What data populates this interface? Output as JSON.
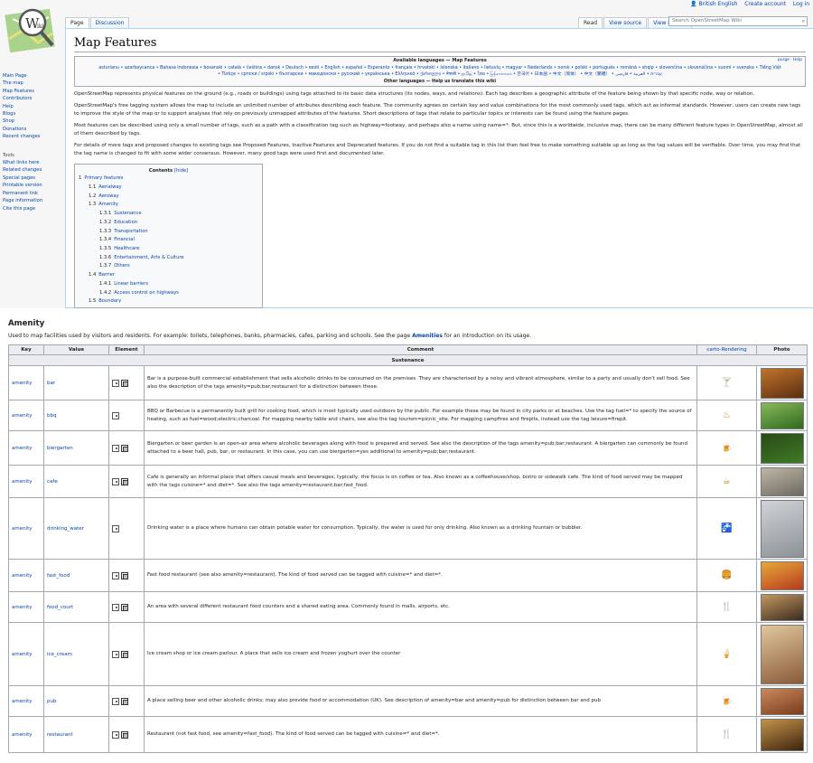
{
  "personal": {
    "lang": "British English",
    "create": "Create account",
    "login": "Log in"
  },
  "tabs": {
    "page": "Page",
    "discussion": "Discussion",
    "read": "Read",
    "view_source": "View source",
    "view_history": "View history"
  },
  "search": {
    "placeholder": "Search OpenStreetMap Wiki"
  },
  "sidebar": {
    "nav": [
      "Main Page",
      "The map",
      "Map Features",
      "Contributors",
      "Help",
      "Blogs",
      "Shop",
      "Donations",
      "Recent changes"
    ],
    "tools_heading": "Tools",
    "tools": [
      "What links here",
      "Related changes",
      "Special pages",
      "Printable version",
      "Permanent link",
      "Page information",
      "Cite this page"
    ]
  },
  "page": {
    "title": "Map Features"
  },
  "langbox": {
    "heading": "Available languages — Map Features",
    "tools": "purge · Help",
    "line1": "asturianu • azərbaycanca • Bahasa Indonesia • bosanski • català • čeština • dansk • Deutsch • eesti • English • español • Esperanto • français • hrvatski • íslenska • italiano • lietuvių • magyar • Nederlands • norsk • polski • português • română • shqip • slovenčina • slovenščina • suomi • svenska • Tiếng Việt",
    "line2": "• Türkçe • српски / srpski • български • македонски • русский • українська • Ελληνικά • ქართული • नेपाली • தமிழ் • ไทย • မြန်မာဘာသာ • 한국어 • 日本語 • 中文（简体） • 中文（繁體） • עברית • العربية • فارسی",
    "other": "Other languages — Help us translate this wiki"
  },
  "paragraphs": {
    "p1": "OpenStreetMap represents physical features on the ground (e.g., roads or buildings) using tags attached to its basic data structures (its nodes, ways, and relations). Each tag describes a geographic attribute of the feature being shown by that specific node, way or relation.",
    "p2": "OpenStreetMap's free tagging system allows the map to include an unlimited number of attributes describing each feature. The community agrees on certain key and value combinations for the most commonly used tags, which act as informal standards. However, users can create new tags to improve the style of the map or to support analyses that rely on previously unmapped attributes of the features. Short descriptions of tags that relate to particular topics or interests can be found using the feature pages.",
    "p3": "Most features can be described using only a small number of tags, such as a path with a classification tag such as highway=footway, and perhaps also a name using name=*. But, since this is a worldwide, inclusive map, there can be many different feature types in OpenStreetMap, almost all of them described by tags.",
    "p4": "For details of more tags and proposed changes to existing tags see Proposed Features, Inactive Features and Deprecated features. If you do not find a suitable tag in this list then feel free to make something suitable up as long as the tag values will be verifiable. Over time, you may find that the tag name is changed to fit with some wider consensus. However, many good tags were used first and documented later."
  },
  "toc": {
    "title": "Contents",
    "hide": "[hide]",
    "items": [
      {
        "num": "1",
        "text": "Primary features",
        "level": 1
      },
      {
        "num": "1.1",
        "text": "Aerialway",
        "level": 2
      },
      {
        "num": "1.2",
        "text": "Aeroway",
        "level": 2
      },
      {
        "num": "1.3",
        "text": "Amenity",
        "level": 2
      },
      {
        "num": "1.3.1",
        "text": "Sustenance",
        "level": 3
      },
      {
        "num": "1.3.2",
        "text": "Education",
        "level": 3
      },
      {
        "num": "1.3.3",
        "text": "Transportation",
        "level": 3
      },
      {
        "num": "1.3.4",
        "text": "Financial",
        "level": 3
      },
      {
        "num": "1.3.5",
        "text": "Healthcare",
        "level": 3
      },
      {
        "num": "1.3.6",
        "text": "Entertainment, Arts & Culture",
        "level": 3
      },
      {
        "num": "1.3.7",
        "text": "Others",
        "level": 3
      },
      {
        "num": "1.4",
        "text": "Barrier",
        "level": 2
      },
      {
        "num": "1.4.1",
        "text": "Linear barriers",
        "level": 3
      },
      {
        "num": "1.4.2",
        "text": "Access control on highways",
        "level": 3
      },
      {
        "num": "1.5",
        "text": "Boundary",
        "level": 2
      }
    ]
  },
  "amenity": {
    "heading": "Amenity",
    "desc_a": "Used to map facilities used by visitors and residents. For example: toilets, telephones, banks, pharmacies, cafes, parking and schools. See the page ",
    "desc_link": "Amenities",
    "desc_b": " for an introduction on its usage."
  },
  "table": {
    "headers": {
      "key": "Key",
      "value": "Value",
      "element": "Element",
      "comment": "Comment",
      "render": "carto-Rendering",
      "photo": "Photo"
    },
    "subheading": "Sustenance",
    "rows": [
      {
        "key": "amenity",
        "value": "bar",
        "comment": "Bar is a purpose-built commercial establishment that sells alcoholic drinks to be consumed on the premises. They are characterised by a noisy and vibrant atmosphere, similar to a party and usually don't sell food. See also the description of the tags amenity=pub;bar;restaurant for a distinction between these.",
        "icon": "cocktail-icon",
        "glyph": "🍸"
      },
      {
        "key": "amenity",
        "value": "bbq",
        "comment": "BBQ or Barbecue is a permanently built grill for cooking food, which is most typically used outdoors by the public. For example these may be found in city parks or at beaches. Use the tag fuel=* to specify the source of heating, such as fuel=wood;electric;charcoal. For mapping nearby table and chairs, see also the tag tourism=picnic_site. For mapping campfires and firepits, instead use the tag leisure=firepit.",
        "icon": "bbq-icon",
        "glyph": "♨"
      },
      {
        "key": "amenity",
        "value": "biergarten",
        "comment": "Biergarten or beer garden is an open-air area where alcoholic beverages along with food is prepared and served. See also the description of the tags amenity=pub;bar;restaurant. A biergarten can commonly be found attached to a beer hall, pub, bar, or restaurant. In this case, you can use biergarten=yes additional to amenity=pub;bar;restaurant.",
        "icon": "beer-mug-icon",
        "glyph": "🍺"
      },
      {
        "key": "amenity",
        "value": "cafe",
        "comment": "Cafe is generally an informal place that offers casual meals and beverages; typically, the focus is on coffee or tea. Also known as a coffeehouse/shop, bistro or sidewalk cafe. The kind of food served may be mapped with the tags cuisine=* and diet=*. See also the tags amenity=restaurant;bar;fast_food.",
        "icon": "coffee-cup-icon",
        "glyph": "☕"
      },
      {
        "key": "amenity",
        "value": "drinking_water",
        "comment": "Drinking water is a place where humans can obtain potable water for consumption. Typically, the water is used for only drinking. Also known as a drinking fountain or bubbler.",
        "icon": "water-tap-icon",
        "glyph": "🚰"
      },
      {
        "key": "amenity",
        "value": "fast_food",
        "comment": "Fast food restaurant (see also amenity=restaurant). The kind of food served can be tagged with cuisine=* and diet=*.",
        "icon": "burger-icon",
        "glyph": "🍔"
      },
      {
        "key": "amenity",
        "value": "food_court",
        "comment": "An area with several different restaurant food counters and a shared eating area. Commonly found in malls, airports, etc.",
        "icon": "fork-knife-icon",
        "glyph": "🍴"
      },
      {
        "key": "amenity",
        "value": "ice_cream",
        "comment": "Ice cream shop or ice cream parlour. A place that sells ice cream and frozen yoghurt over the counter",
        "icon": "ice-cream-icon",
        "glyph": "🍦"
      },
      {
        "key": "amenity",
        "value": "pub",
        "comment": "A place selling beer and other alcoholic drinks; may also provide food or accommodation (UK). See description of amenity=bar and amenity=pub for distinction between bar and pub",
        "icon": "pint-glass-icon",
        "glyph": "🍺"
      },
      {
        "key": "amenity",
        "value": "restaurant",
        "comment": "Restaurant (not fast food, see amenity=fast_food). The kind of food served can be tagged with cuisine=* and diet=*.",
        "icon": "fork-knife-icon",
        "glyph": "🍴"
      }
    ]
  },
  "colors": {
    "link": "#0645ad",
    "icon": "#c5800a",
    "border": "#a2a9b1",
    "header_bg": "#eaecf0"
  }
}
